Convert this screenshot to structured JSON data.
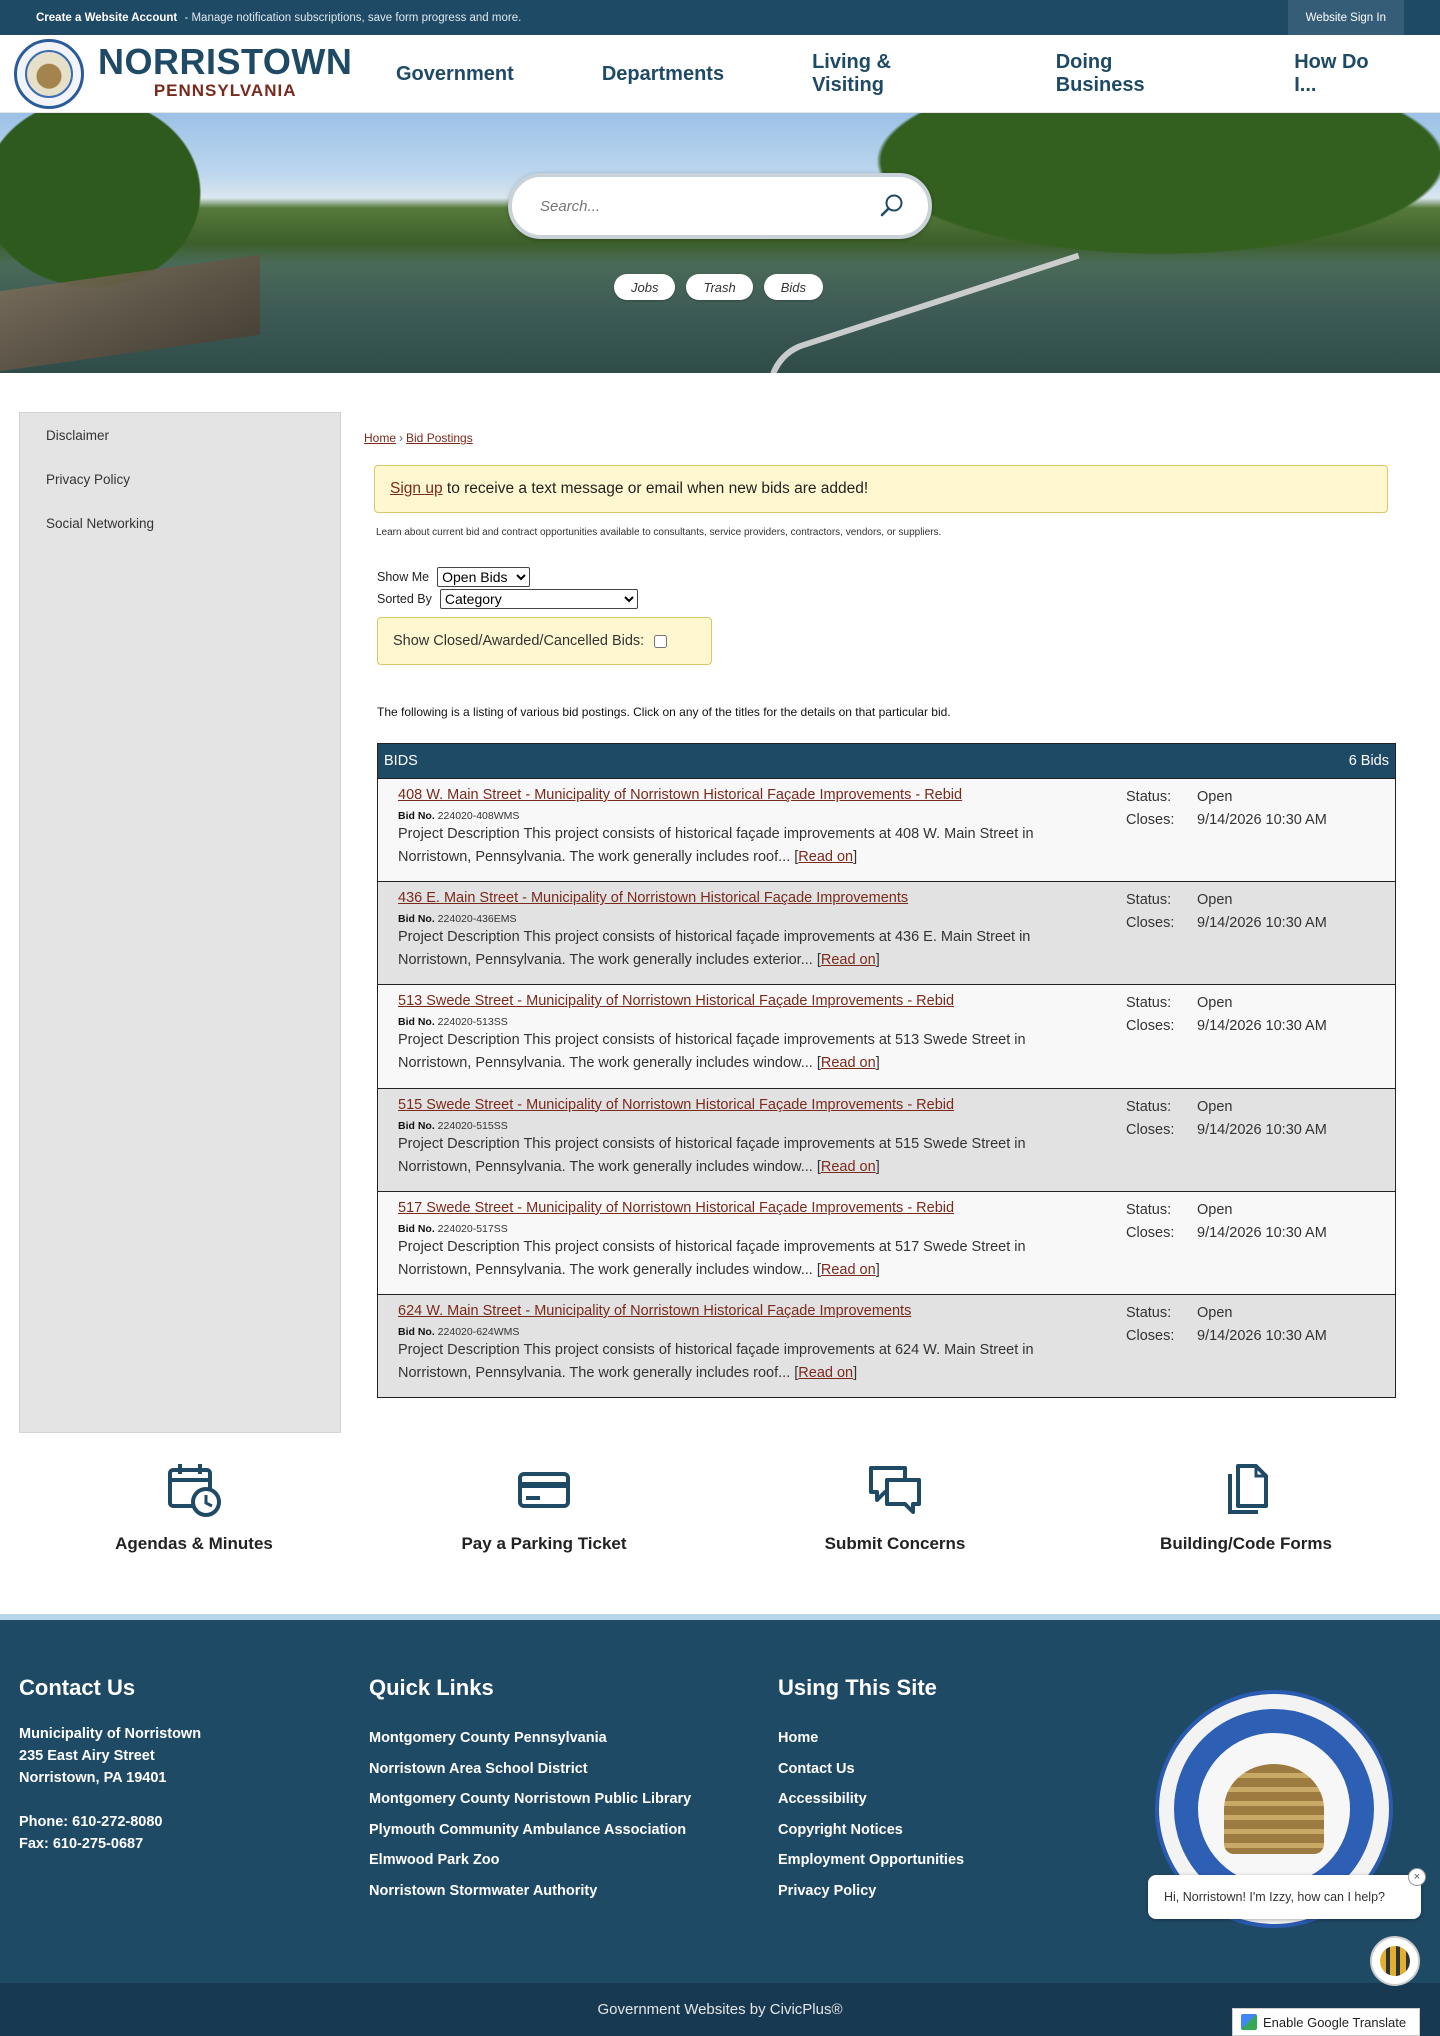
{
  "topbar": {
    "create_account": "Create a Website Account",
    "description": "- Manage notification subscriptions, save form progress and more.",
    "sign_in": "Website Sign In"
  },
  "brand": {
    "town": "NORRISTOWN",
    "state": "PENNSYLVANIA"
  },
  "nav": [
    "Government",
    "Departments",
    "Living & Visiting",
    "Doing Business",
    "How Do I..."
  ],
  "search": {
    "placeholder": "Search..."
  },
  "quick_pills": [
    "Jobs",
    "Trash",
    "Bids"
  ],
  "sidebar": [
    "Disclaimer",
    "Privacy Policy",
    "Social Networking"
  ],
  "breadcrumb": {
    "home": "Home",
    "sep": "›",
    "current": "Bid Postings"
  },
  "signup": {
    "link": "Sign up",
    "text": " to receive a text message or email when new bids are added!"
  },
  "learn_text": "Learn about current bid and contract opportunities available to consultants, service providers, contractors, vendors, or suppliers.",
  "filters": {
    "show_me_label": "Show Me",
    "show_me_value": "Open Bids",
    "sorted_by_label": "Sorted By",
    "sorted_by_value": "Category",
    "closed_label": "Show Closed/Awarded/Cancelled Bids:"
  },
  "listing_text": "The following is a listing of various bid postings. Click on any of the titles for the details on that particular bid.",
  "bids": {
    "header": "BIDS",
    "count": "6 Bids",
    "bid_no_label": "Bid No.",
    "status_label": "Status:",
    "closes_label": "Closes:",
    "read_on": "Read on",
    "items": [
      {
        "title": "408 W. Main Street - Municipality of Norristown Historical Façade Improvements - Rebid",
        "bid_no": "224020-408WMS",
        "desc": "Project Description This project consists of historical façade improvements at 408 W. Main Street in Norristown, Pennsylvania. The work generally includes roof... ",
        "status": "Open",
        "closes": "9/14/2026 10:30 AM"
      },
      {
        "title": "436 E. Main Street - Municipality of Norristown Historical Façade Improvements",
        "bid_no": "224020-436EMS",
        "desc": "Project Description This project consists of historical façade improvements at 436 E. Main Street in Norristown, Pennsylvania. The work generally includes exterior... ",
        "status": "Open",
        "closes": "9/14/2026 10:30 AM"
      },
      {
        "title": "513 Swede Street - Municipality of Norristown Historical Façade Improvements - Rebid",
        "bid_no": "224020-513SS",
        "desc": "Project Description This project consists of historical façade improvements at 513 Swede Street in Norristown, Pennsylvania. The work generally includes window... ",
        "status": "Open",
        "closes": "9/14/2026 10:30 AM"
      },
      {
        "title": "515 Swede Street - Municipality of Norristown Historical Façade Improvements - Rebid",
        "bid_no": "224020-515SS",
        "desc": "Project Description This project consists of historical façade improvements at 515 Swede Street in Norristown, Pennsylvania. The work generally includes window... ",
        "status": "Open",
        "closes": "9/14/2026 10:30 AM"
      },
      {
        "title": "517 Swede Street - Municipality of Norristown Historical Façade Improvements - Rebid",
        "bid_no": "224020-517SS",
        "desc": "Project Description This project consists of historical façade improvements at 517 Swede Street in Norristown, Pennsylvania. The work generally includes window... ",
        "status": "Open",
        "closes": "9/14/2026 10:30 AM"
      },
      {
        "title": "624 W. Main Street - Municipality of Norristown Historical Façade Improvements",
        "bid_no": "224020-624WMS",
        "desc": "Project Description This project consists of historical façade improvements at 624 W. Main Street in Norristown, Pennsylvania. The work generally includes roof... ",
        "status": "Open",
        "closes": "9/14/2026 10:30 AM"
      }
    ]
  },
  "quick_icons": [
    {
      "label": "Agendas & Minutes",
      "icon": "calendar-clock-icon"
    },
    {
      "label": "Pay a Parking Ticket",
      "icon": "credit-card-icon"
    },
    {
      "label": "Submit Concerns",
      "icon": "chat-bubbles-icon"
    },
    {
      "label": "Building/Code Forms",
      "icon": "documents-icon"
    }
  ],
  "footer": {
    "contact": {
      "heading": "Contact Us",
      "org": "Municipality of Norristown",
      "street": "235 East Airy Street",
      "city": "Norristown, PA 19401",
      "phone": "Phone: 610-272-8080",
      "fax": "Fax: 610-275-0687"
    },
    "quick_links": {
      "heading": "Quick Links",
      "items": [
        "Montgomery County Pennsylvania",
        "Norristown Area School District",
        "Montgomery County Norristown Public Library",
        "Plymouth Community Ambulance Association",
        "Elmwood Park Zoo",
        "Norristown Stormwater Authority"
      ]
    },
    "using_site": {
      "heading": "Using This Site",
      "items": [
        "Home",
        "Contact Us",
        "Accessibility",
        "Copyright Notices",
        "Employment Opportunities",
        "Privacy Policy"
      ]
    },
    "credit": "Government Websites by CivicPlus®"
  },
  "chat": {
    "message": "Hi, Norristown! I'm Izzy, how can I help?",
    "close": "×"
  },
  "translate": "Enable Google Translate",
  "colors": {
    "primary": "#1f4a66",
    "accent": "#7a2a1d",
    "highlight": "#fff7cf"
  }
}
